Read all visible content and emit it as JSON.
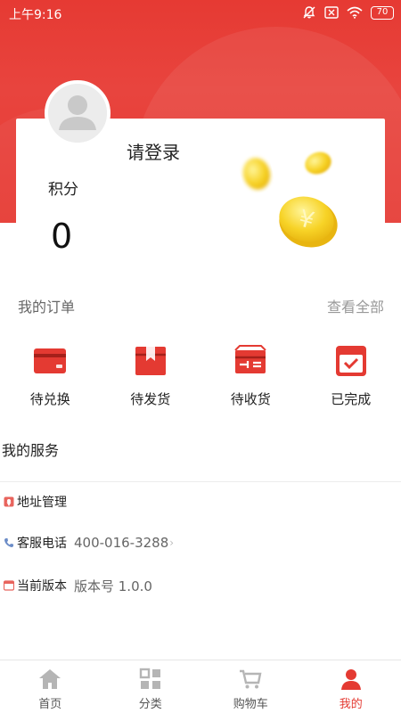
{
  "status_bar": {
    "time": "上午9:16",
    "battery": "70"
  },
  "profile": {
    "login_text": "请登录",
    "points_label": "积分",
    "points_value": "0"
  },
  "orders": {
    "title": "我的订单",
    "view_all": "查看全部",
    "items": [
      {
        "label": "待兑换",
        "icon": "card-icon"
      },
      {
        "label": "待发货",
        "icon": "package-icon"
      },
      {
        "label": "待收货",
        "icon": "open-box-icon"
      },
      {
        "label": "已完成",
        "icon": "calendar-check-icon"
      }
    ]
  },
  "services": {
    "title": "我的服务",
    "items": [
      {
        "label": "地址管理",
        "value": "",
        "icon": "location-pin-icon"
      },
      {
        "label": "客服电话",
        "value": "400-016-3288",
        "icon": "phone-icon"
      },
      {
        "label": "当前版本",
        "value": "版本号 1.0.0",
        "icon": "version-icon"
      }
    ]
  },
  "tabs": [
    {
      "label": "首页",
      "icon": "home-icon"
    },
    {
      "label": "分类",
      "icon": "category-grid-icon"
    },
    {
      "label": "购物车",
      "icon": "cart-icon"
    },
    {
      "label": "我的",
      "icon": "person-icon"
    }
  ],
  "colors": {
    "brand_red": "#e63a33",
    "icon_red": "#e43a32",
    "inactive_icon": "#b5b5b5"
  }
}
